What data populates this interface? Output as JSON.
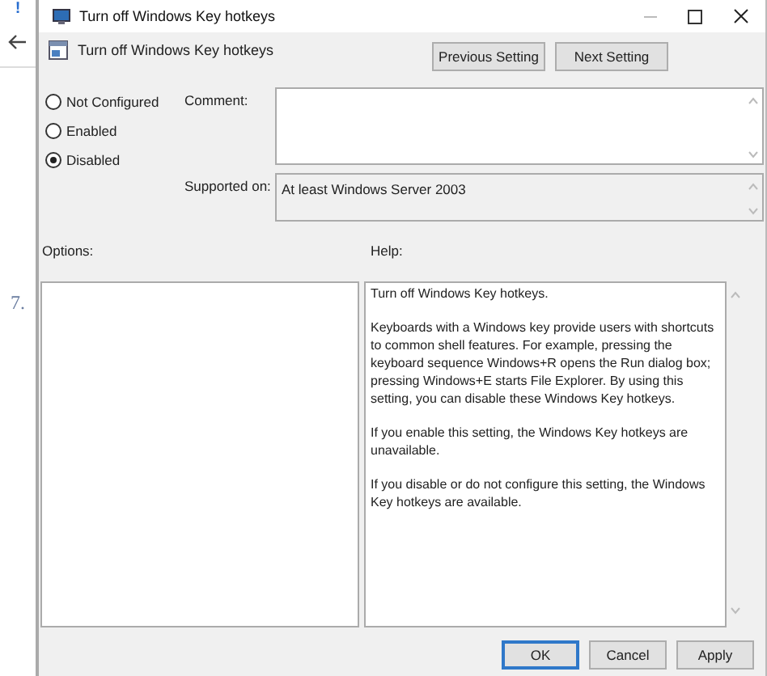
{
  "background_window": {
    "marker": "!",
    "list_number": "7."
  },
  "window": {
    "title": "Turn off Windows Key hotkeys"
  },
  "header": {
    "setting_name": "Turn off Windows Key hotkeys"
  },
  "nav_buttons": [
    "Previous Setting",
    "Next Setting"
  ],
  "states": [
    {
      "label": "Not Configured",
      "selected": false
    },
    {
      "label": "Enabled",
      "selected": false
    },
    {
      "label": "Disabled",
      "selected": true
    }
  ],
  "comment": {
    "label": "Comment:"
  },
  "supported_on": {
    "label": "Supported on:",
    "value": "At least Windows Server 2003"
  },
  "options_pane": {
    "label": "Options:"
  },
  "help_pane": {
    "label": "Help:",
    "paragraphs": [
      "Turn off Windows Key hotkeys.",
      "Keyboards with a Windows key provide users with shortcuts to common shell features. For example, pressing the keyboard sequence Windows+R opens the Run dialog box; pressing Windows+E starts File Explorer. By using this setting, you can disable these Windows Key hotkeys.",
      "If you enable this setting, the Windows Key hotkeys are unavailable.",
      "If you disable or do not configure this setting, the Windows Key hotkeys are available."
    ]
  },
  "buttons": [
    {
      "label": "OK",
      "default": true
    },
    {
      "label": "Cancel",
      "default": false
    },
    {
      "label": "Apply",
      "default": false
    }
  ]
}
